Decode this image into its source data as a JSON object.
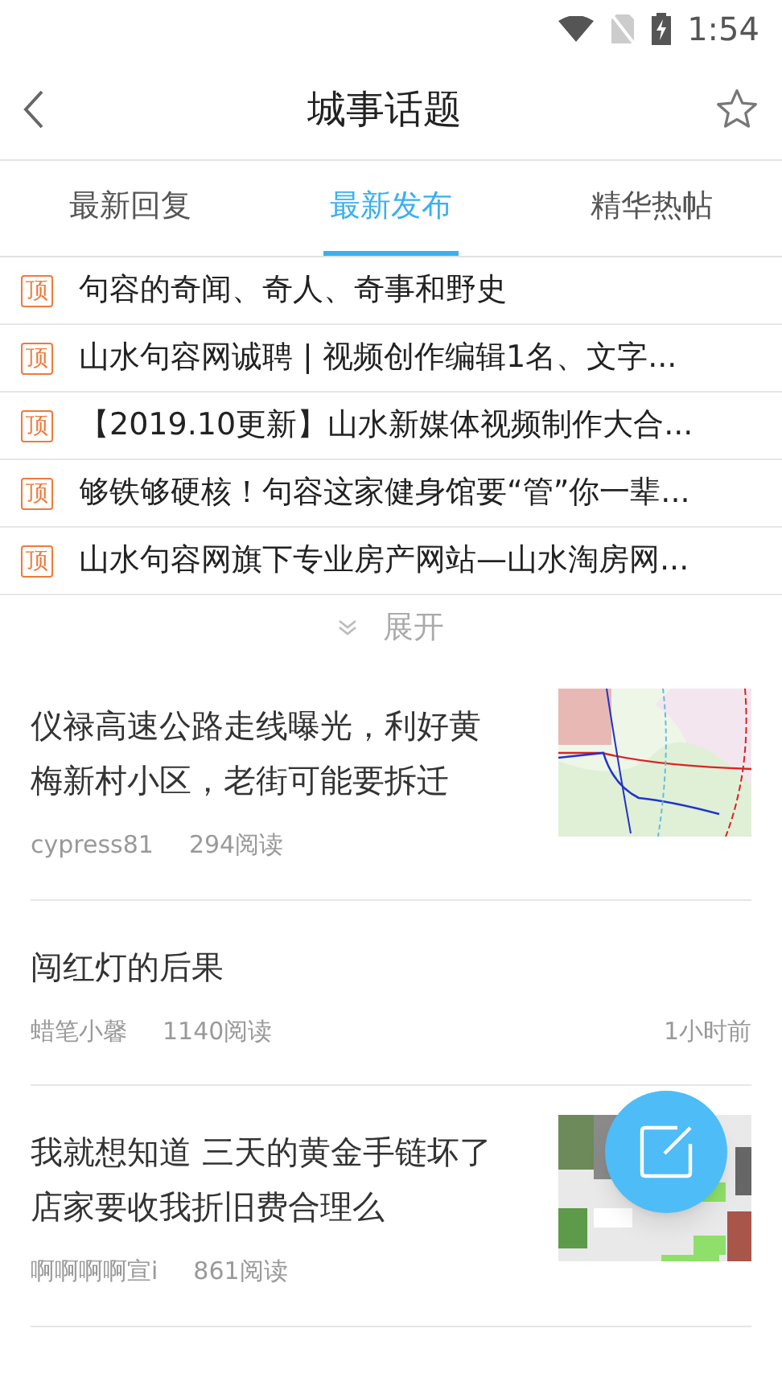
{
  "status_bar": {
    "time": "1:54"
  },
  "header": {
    "title": "城事话题"
  },
  "tabs": [
    {
      "label": "最新回复",
      "selected": false
    },
    {
      "label": "最新发布",
      "selected": true
    },
    {
      "label": "精华热帖",
      "selected": false
    }
  ],
  "pinned": [
    {
      "badge": "顶",
      "title": "句容的奇闻、奇人、奇事和野史"
    },
    {
      "badge": "顶",
      "title": "山水句容网诚聘 | 视频创作编辑1名、文字..."
    },
    {
      "badge": "顶",
      "title": "【2019.10更新】山水新媒体视频制作大合..."
    },
    {
      "badge": "顶",
      "title": "够铁够硬核！句容这家健身馆要“管”你一辈..."
    },
    {
      "badge": "顶",
      "title": "山水句容网旗下专业房产网站—山水淘房网..."
    }
  ],
  "expand": {
    "label": "展开"
  },
  "posts": [
    {
      "title": "仪禄高速公路走线曝光，利好黄梅新村小区，老街可能要拆迁",
      "author": "cypress81",
      "reads": "294阅读",
      "thumb": {
        "kind": "map"
      }
    },
    {
      "title": "闯红灯的后果",
      "author": "蜡笔小馨",
      "reads": "1140阅读",
      "time": "1小时前"
    },
    {
      "title": "我就想知道 三天的黄金手链坏了店家要收我折旧费合理么",
      "author": "啊啊啊啊宣i",
      "reads": "861阅读",
      "thumb": {
        "kind": "collage"
      }
    }
  ]
}
